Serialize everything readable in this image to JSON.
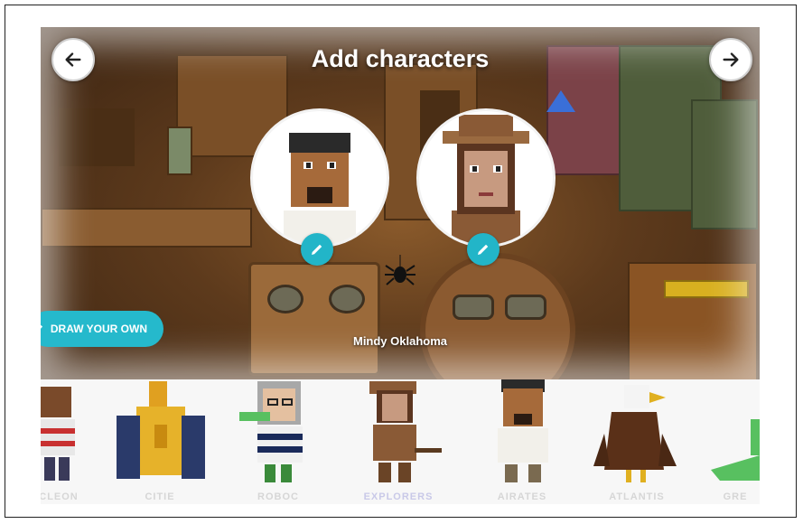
{
  "header": {
    "title": "Add characters",
    "back_icon": "arrow-left-icon",
    "next_icon": "arrow-right-icon"
  },
  "selected_characters": [
    {
      "role": "explorer-man",
      "edit_icon": "pencil-icon"
    },
    {
      "role": "explorer-woman",
      "edit_icon": "pencil-icon"
    }
  ],
  "draw_button": {
    "label": "DRAW YOUR OWN",
    "icon": "pencil-icon"
  },
  "current_character_name": "Mindy Oklahoma",
  "tray": {
    "items": [
      {
        "label": "CLEON"
      },
      {
        "label": "CITIE"
      },
      {
        "label": "ROBOC"
      },
      {
        "label": "EXPLORERS"
      },
      {
        "label": "AIRATES"
      },
      {
        "label": "ATLANTIS"
      },
      {
        "label": "GRE"
      }
    ]
  },
  "colors": {
    "accent": "#25b9cc",
    "title_text": "#ffffff",
    "tray_bg": "#f7f7f7"
  }
}
